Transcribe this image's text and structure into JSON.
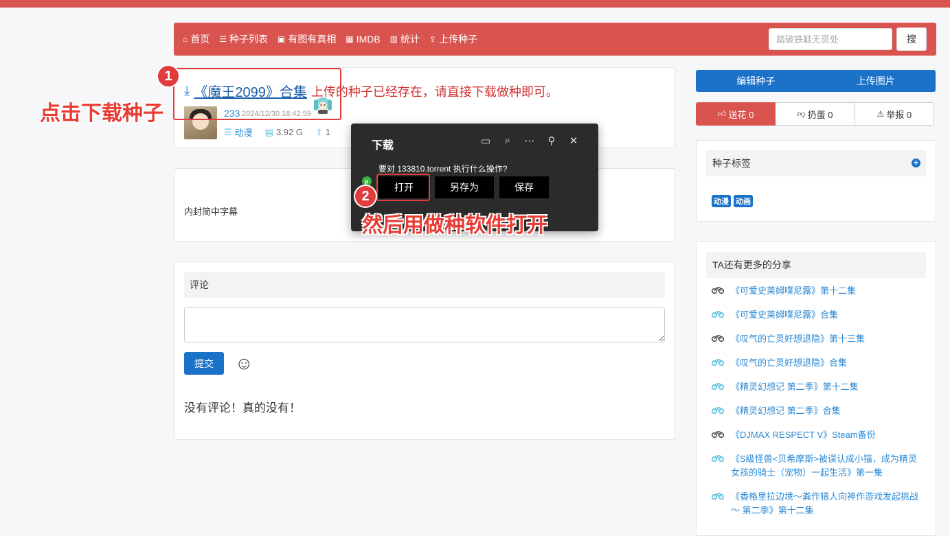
{
  "nav": {
    "items": [
      {
        "icon": "home-icon",
        "glyph": "⌂",
        "label": "首页"
      },
      {
        "icon": "list-icon",
        "glyph": "☰",
        "label": "种子列表"
      },
      {
        "icon": "picture-icon",
        "glyph": "▣",
        "label": "有图有真相"
      },
      {
        "icon": "film-icon",
        "glyph": "▦",
        "label": "IMDB"
      },
      {
        "icon": "bar-chart-icon",
        "glyph": "▥",
        "label": "统计"
      },
      {
        "icon": "upload-icon",
        "glyph": "⇪",
        "label": "上传种子"
      }
    ],
    "search_placeholder": "踏破铁鞋无觅处",
    "search_button": "搜"
  },
  "torrent": {
    "title": "《魔王2099》合集",
    "message": "上传的种子已经存在，请直接下载做种即可。",
    "uploader": "233",
    "time": "2024/12/30 18:42:59",
    "category": "动漫",
    "size": "3.92 G",
    "seeders": "1"
  },
  "description": "内封简中字幕",
  "comments": {
    "header": "评论",
    "submit": "提交",
    "smile": "☺",
    "empty": "没有评论！真的没有！"
  },
  "sidebar": {
    "tabs": [
      "编辑种子",
      "上传图片"
    ],
    "actions": {
      "flower": "送花 0",
      "egg": "扔蛋 0",
      "report": "举报 0"
    },
    "tags_header": "种子标签",
    "tags": [
      "动漫",
      "动画"
    ],
    "more_header": "TA还有更多的分享",
    "more_items": [
      {
        "title": "《可爱史莱姆噗尼露》第十二集",
        "active": true
      },
      {
        "title": "《可爱史莱姆噗尼露》合集",
        "active": false
      },
      {
        "title": "《叹气的亡灵好想退隐》第十三集",
        "active": true
      },
      {
        "title": "《叹气的亡灵好想退隐》合集",
        "active": false
      },
      {
        "title": "《精灵幻想记 第二季》第十二集",
        "active": false
      },
      {
        "title": "《精灵幻想记 第二季》合集",
        "active": false
      },
      {
        "title": "《DJMAX RESPECT V》Steam备份",
        "active": true
      },
      {
        "title": "《S级怪兽<贝希摩斯>被误认成小猫，成为精灵女孩的骑士（宠物）一起生活》第一集",
        "active": false
      },
      {
        "title": "《香格里拉边境～粪作猎人向神作游戏发起挑战～ 第二季》第十二集",
        "active": false
      }
    ]
  },
  "download_popup": {
    "title": "下载",
    "question": "要对 133810.torrent 执行什么操作?",
    "open": "打开",
    "save_as": "另存为",
    "save": "保存"
  },
  "annotations": {
    "step1_badge": "1",
    "step1_text": "点击下载种子",
    "step2_badge": "2",
    "step2_text": "然后用做种软件打开"
  },
  "colors": {
    "brand_red": "#d9534f",
    "accent_blue": "#1a72c9",
    "annotation_red": "#e83c34"
  }
}
